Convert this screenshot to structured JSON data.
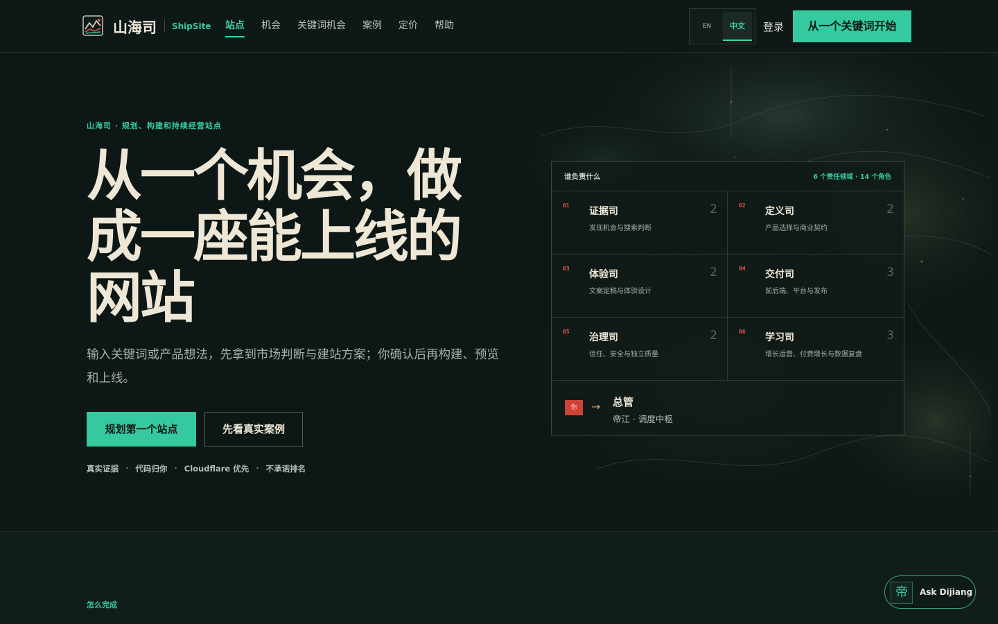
{
  "header": {
    "brand_cn": "山海司",
    "brand_en": "ShipSite",
    "nav": [
      {
        "label": "站点",
        "active": true
      },
      {
        "label": "机会"
      },
      {
        "label": "关键词机会"
      },
      {
        "label": "案例"
      },
      {
        "label": "定价"
      },
      {
        "label": "帮助"
      }
    ],
    "lang_en": "EN",
    "lang_zh": "中文",
    "login": "登录",
    "cta": "从一个关键词开始"
  },
  "hero": {
    "eyebrow": "山海司 · 规划、构建和持续经营站点",
    "headline": "从一个机会，做成一座能上线的网站",
    "subtitle": "输入关键词或产品想法，先拿到市场判断与建站方案；你确认后再构建、预览和上线。",
    "primary_button": "规划第一个站点",
    "secondary_button": "先看真实案例",
    "trust": [
      "真实证据",
      "代码归你",
      "Cloudflare 优先",
      "不承诺排名"
    ]
  },
  "panel": {
    "title": "谁负责什么",
    "stats": "6 个责任领域 · 14 个角色",
    "departments": [
      {
        "num": "01",
        "title": "证据司",
        "desc": "发现机会与搜索判断",
        "count": "2"
      },
      {
        "num": "02",
        "title": "定义司",
        "desc": "产品选择与商业契约",
        "count": "2"
      },
      {
        "num": "03",
        "title": "体验司",
        "desc": "文案定稿与体验设计",
        "count": "2"
      },
      {
        "num": "04",
        "title": "交付司",
        "desc": "前后端、平台与发布",
        "count": "3"
      },
      {
        "num": "05",
        "title": "治理司",
        "desc": "信任、安全与独立质量",
        "count": "2"
      },
      {
        "num": "06",
        "title": "学习司",
        "desc": "增长运营、付费增长与数据复盘",
        "count": "3"
      }
    ],
    "boss": {
      "you": "你",
      "arrow": "→",
      "title": "总管",
      "sub": "帝江 · 调度中枢"
    }
  },
  "section2": {
    "label": "怎么完成"
  },
  "assistant": {
    "icon": "帝",
    "label": "Ask Dijiang"
  },
  "colors": {
    "accent": "#35c9a0",
    "background": "#0d1715",
    "number_red": "#e0564a",
    "headline": "#efe7d6"
  }
}
